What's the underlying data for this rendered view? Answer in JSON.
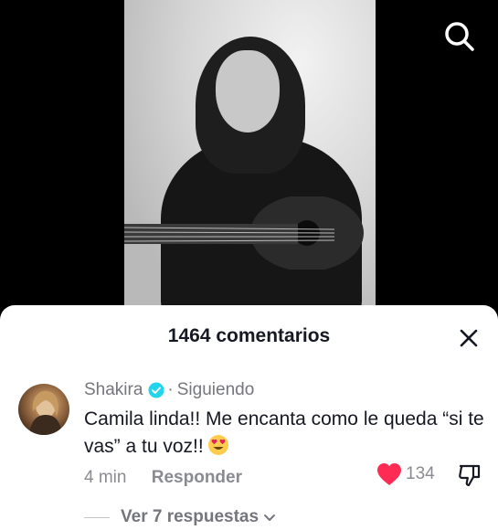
{
  "comments_sheet": {
    "title": "1464 comentarios"
  },
  "comment": {
    "author": "Shakira",
    "separator": "·",
    "follow_status": "Siguiendo",
    "text": "Camila linda!! Me encanta como le queda “si te vas” a tu voz!!",
    "emoji": "heart-eyes",
    "time": "4 min",
    "reply_label": "Responder",
    "like_count": "134",
    "view_replies_label": "Ver 7 respuestas"
  },
  "icons": {
    "search": "search-icon",
    "close": "close-icon",
    "verified": "verified-icon",
    "like": "heart-icon",
    "dislike": "thumbs-down-icon",
    "expand": "chevron-down-icon"
  },
  "colors": {
    "verified": "#20d5ec",
    "like": "#fe2c55",
    "text_primary": "#161823",
    "text_secondary": "#8a8b91"
  }
}
